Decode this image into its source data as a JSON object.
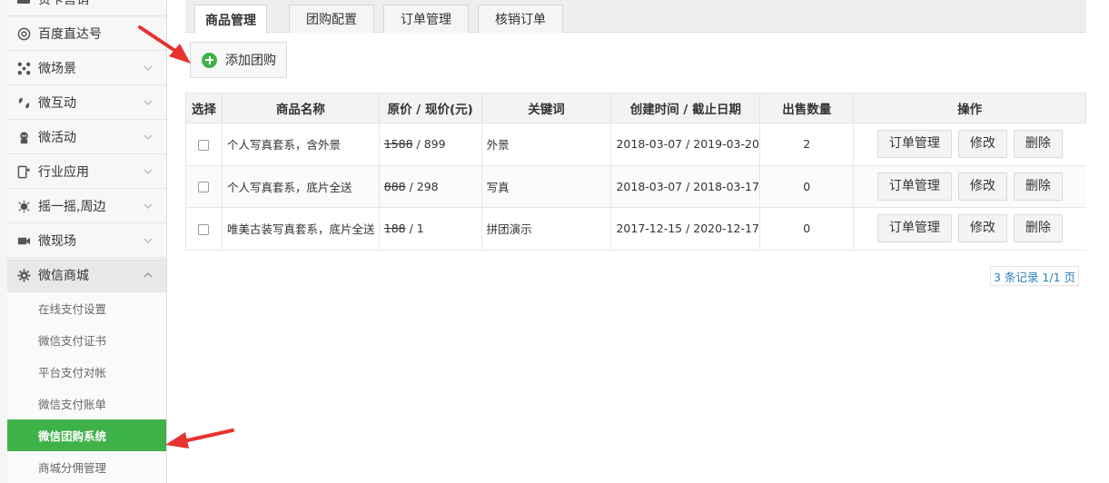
{
  "sidebar": {
    "top_partial_label": "贷卡营销",
    "menu": [
      {
        "label": "百度直达号",
        "icon": "at-sign-icon"
      },
      {
        "label": "微场景",
        "icon": "nodes-icon"
      },
      {
        "label": "微互动",
        "icon": "interaction-icon"
      },
      {
        "label": "微活动",
        "icon": "activity-icon"
      },
      {
        "label": "行业应用",
        "icon": "apps-icon"
      },
      {
        "label": "摇一摇,周边",
        "icon": "shake-icon"
      },
      {
        "label": "微现场",
        "icon": "video-icon"
      },
      {
        "label": "微信商城",
        "icon": "gear-icon"
      }
    ],
    "submenu": [
      {
        "label": "在线支付设置"
      },
      {
        "label": "微信支付证书"
      },
      {
        "label": "平台支付对帐"
      },
      {
        "label": "微信支付账单"
      },
      {
        "label": "微信团购系统"
      },
      {
        "label": "商城分佣管理"
      }
    ]
  },
  "tabs": [
    {
      "label": "商品管理"
    },
    {
      "label": "团购配置"
    },
    {
      "label": "订单管理"
    },
    {
      "label": "核销订单"
    }
  ],
  "toolbar": {
    "add_label": "添加团购"
  },
  "table": {
    "headers": [
      "选择",
      "商品名称",
      "原价 / 现价(元)",
      "关键词",
      "创建时间 / 截止日期",
      "出售数量",
      "操作"
    ],
    "rows": [
      {
        "name": "个人写真套系，含外景",
        "orig_price": "1588",
        "price_sep": " / ",
        "cur_price": "899",
        "keyword": "外景",
        "dates": "2018-03-07 / 2019-03-20",
        "sold": "2"
      },
      {
        "name": "个人写真套系，底片全送",
        "orig_price": "888",
        "price_sep": " / ",
        "cur_price": "298",
        "keyword": "写真",
        "dates": "2018-03-07 / 2018-03-17",
        "sold": "0"
      },
      {
        "name": "唯美古装写真套系，底片全送",
        "orig_price": "188",
        "price_sep": " / ",
        "cur_price": "1",
        "keyword": "拼团演示",
        "dates": "2017-12-15 / 2020-12-17",
        "sold": "0"
      }
    ],
    "actions": {
      "order": "订单管理",
      "edit": "修改",
      "delete": "删除"
    }
  },
  "pager": {
    "text": "3 条记录 1/1 页"
  },
  "colors": {
    "accent_green": "#3fb149",
    "arrow_red": "#e8322f",
    "link_blue": "#2c7fbf"
  }
}
